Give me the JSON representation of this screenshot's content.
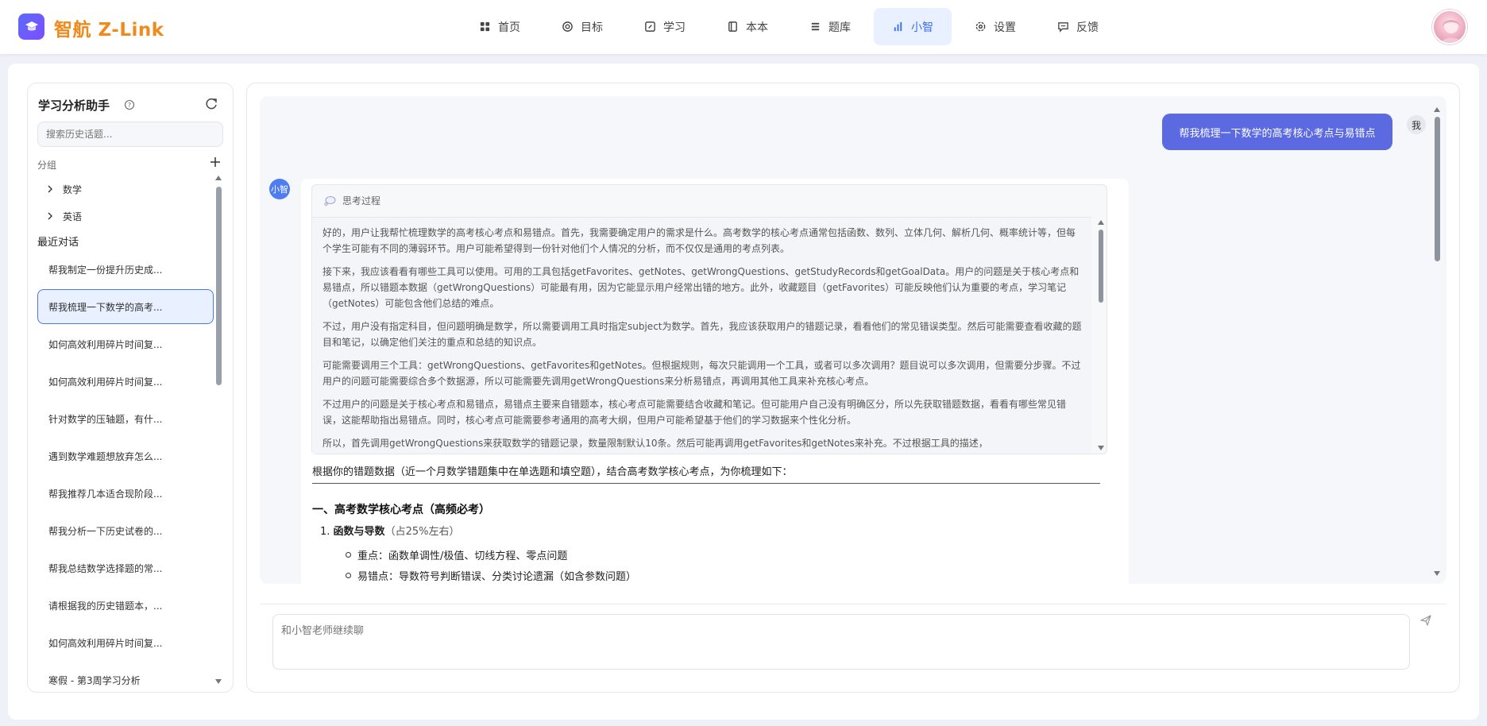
{
  "app": {
    "title": "智航 Z-Link"
  },
  "nav": {
    "items": [
      {
        "label": "首页",
        "icon": "grid-icon"
      },
      {
        "label": "目标",
        "icon": "target-icon"
      },
      {
        "label": "学习",
        "icon": "edit-icon"
      },
      {
        "label": "本本",
        "icon": "book-icon"
      },
      {
        "label": "题库",
        "icon": "list-icon"
      },
      {
        "label": "小智",
        "icon": "bar-chart-icon",
        "active": true
      },
      {
        "label": "设置",
        "icon": "gear-icon"
      },
      {
        "label": "反馈",
        "icon": "message-icon"
      }
    ]
  },
  "sidebar": {
    "title": "学习分析助手",
    "search_placeholder": "搜索历史话题...",
    "group_label": "分组",
    "groups": [
      "数学",
      "英语"
    ],
    "recent_label": "最近对话",
    "conversations": [
      "帮我制定一份提升历史成...",
      "帮我梳理一下数学的高考...",
      "如何高效利用碎片时间复...",
      "如何高效利用碎片时间复...",
      "针对数学的压轴题，有什...",
      "遇到数学难题想放弃怎么...",
      "帮我推荐几本适合现阶段...",
      "帮我分析一下历史试卷的...",
      "帮我总结数学选择题的常...",
      "请根据我的历史错题本，...",
      "如何高效利用碎片时间复...",
      "寒假 - 第3周学习分析"
    ],
    "active_index": 1
  },
  "chat": {
    "user_message": "帮我梳理一下数学的高考核心考点与易错点",
    "user_avatar": "我",
    "bot_avatar": "小智",
    "thinking_label": "思考过程",
    "thinking_paragraphs": [
      "好的，用户让我帮忙梳理数学的高考核心考点和易错点。首先，我需要确定用户的需求是什么。高考数学的核心考点通常包括函数、数列、立体几何、解析几何、概率统计等，但每个学生可能有不同的薄弱环节。用户可能希望得到一份针对他们个人情况的分析，而不仅仅是通用的考点列表。",
      "接下来，我应该看看有哪些工具可以使用。可用的工具包括getFavorites、getNotes、getWrongQuestions、getStudyRecords和getGoalData。用户的问题是关于核心考点和易错点，所以错题本数据（getWrongQuestions）可能最有用，因为它能显示用户经常出错的地方。此外，收藏题目（getFavorites）可能反映他们认为重要的考点，学习笔记（getNotes）可能包含他们总结的难点。",
      "不过，用户没有指定科目，但问题明确是数学，所以需要调用工具时指定subject为数学。首先，我应该获取用户的错题记录，看看他们的常见错误类型。然后可能需要查看收藏的题目和笔记，以确定他们关注的重点和总结的知识点。",
      "可能需要调用三个工具：getWrongQuestions、getFavorites和getNotes。但根据规则，每次只能调用一个工具，或者可以多次调用？题目说可以多次调用，但需要分步骤。不过用户的问题可能需要综合多个数据源，所以可能需要先调用getWrongQuestions来分析易错点，再调用其他工具来补充核心考点。",
      "不过用户的问题是关于核心考点和易错点，易错点主要来自错题本，核心考点可能需要结合收藏和笔记。但可能用户自己没有明确区分，所以先获取错题数据，看看有哪些常见错误，这能帮助指出易错点。同时，核心考点可能需要参考通用的高考大纲，但用户可能希望基于他们的学习数据来个性化分析。",
      "所以，首先调用getWrongQuestions来获取数学的错题记录，数量限制默认10条。然后可能再调用getFavorites和getNotes来补充。不过根据工具的描述，"
    ],
    "answer_intro": "根据你的错题数据（近一个月数学错题集中在单选题和填空题），结合高考数学核心考点，为你梳理如下：",
    "answer_heading": "一、高考数学核心考点（高频必考）",
    "answer_item_number": "1.",
    "answer_item_title": "函数与导数",
    "answer_item_note": "（占25%左右）",
    "answer_subpoints": [
      "重点：函数单调性/极值、切线方程、零点问题",
      "易错点：导数符号判断错误、分类讨论遗漏（如含参数问题）"
    ],
    "input_placeholder": "和小智老师继续聊"
  },
  "colors": {
    "accent": "#5b6ae0",
    "nav_active": "#3c6ef2",
    "logo_text": "#f08a1c"
  }
}
